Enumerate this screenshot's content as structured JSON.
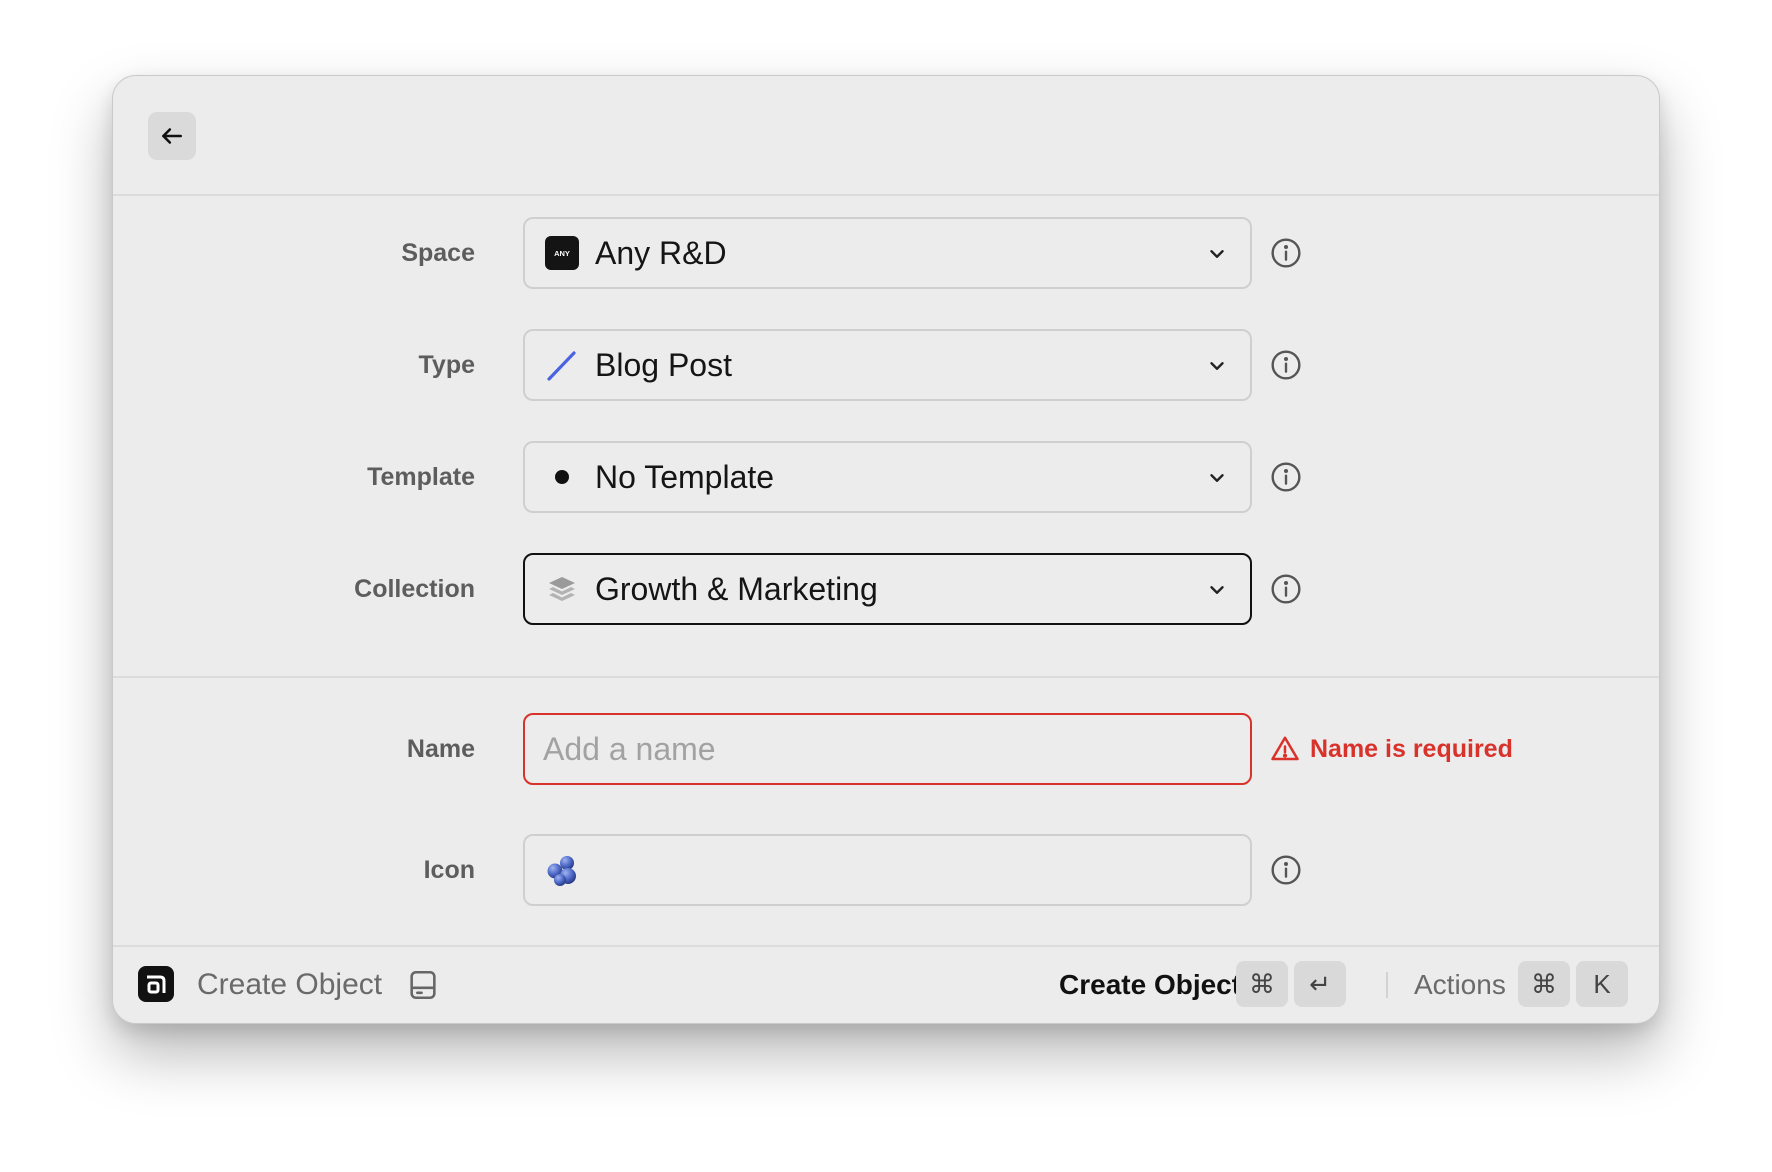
{
  "form": {
    "space": {
      "label": "Space",
      "value": "Any R&D",
      "badge_text": "ANY",
      "icon": "space-badge-icon"
    },
    "type": {
      "label": "Type",
      "value": "Blog Post",
      "icon": "pencil-icon"
    },
    "template": {
      "label": "Template",
      "value": "No Template",
      "icon": "dot-icon"
    },
    "collection": {
      "label": "Collection",
      "value": "Growth & Marketing",
      "icon": "layers-icon"
    },
    "name": {
      "label": "Name",
      "value": "",
      "placeholder": "Add a name",
      "error": "Name is required"
    },
    "icon": {
      "label": "Icon",
      "value": "",
      "icon": "blueberries-icon"
    }
  },
  "footer": {
    "title": "Create Object",
    "primary_action": "Create Object",
    "primary_keys": [
      "⌘",
      "↵"
    ],
    "secondary_action": "Actions",
    "secondary_keys": [
      "⌘",
      "K"
    ]
  },
  "colors": {
    "error": "#d9322b",
    "pencil": "#4a63e0",
    "background": "#ececec"
  }
}
